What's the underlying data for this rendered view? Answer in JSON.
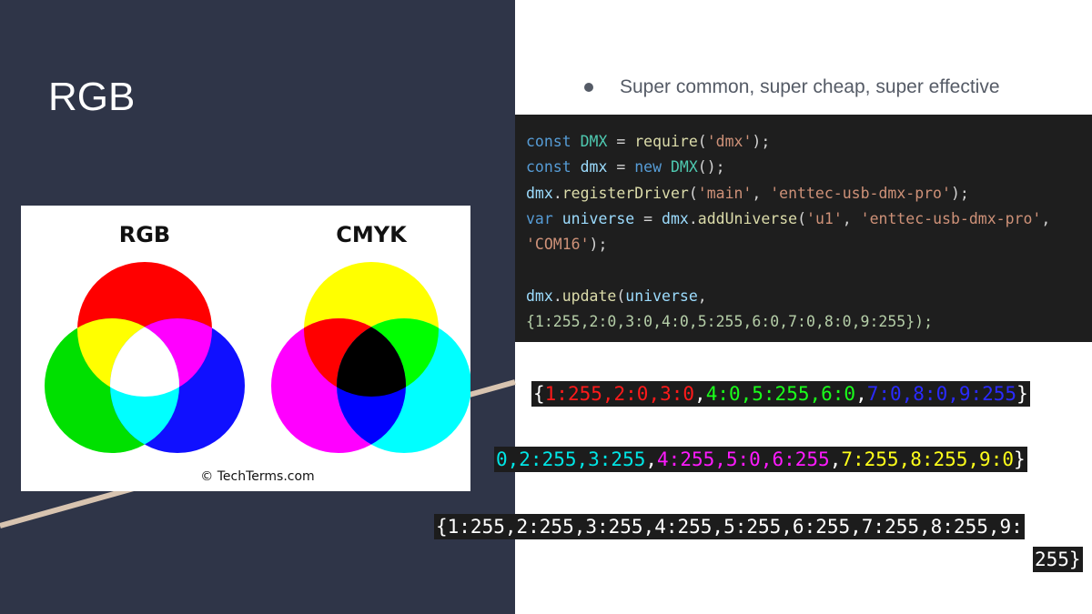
{
  "slide": {
    "title": "RGB",
    "bullet": "Super common, super cheap, super effective"
  },
  "image": {
    "rgb_label": "RGB",
    "cmyk_label": "CMYK",
    "credit": "© TechTerms.com"
  },
  "code": {
    "line1": {
      "k": "const",
      "v": "DMX",
      "op": " = ",
      "f": "require",
      "p1": "(",
      "s": "'dmx'",
      "p2": ");"
    },
    "line2": {
      "k": "const",
      "v": "dmx",
      "op": " = ",
      "k2": "new",
      "c": "DMX",
      "p": "();"
    },
    "line3": {
      "v": "dmx",
      "dot": ".",
      "f": "registerDriver",
      "p1": "(",
      "s1": "'main'",
      "comma": ", ",
      "s2": "'enttec-usb-dmx-pro'",
      "p2": ");"
    },
    "line4": {
      "k": "var",
      "v": "universe",
      "op": " = ",
      "v2": "dmx",
      "dot": ".",
      "f": "addUniverse",
      "p1": "(",
      "s1": "'u1'",
      "comma": ", ",
      "s2": "'enttec-usb-dmx-pro'",
      "p2": ","
    },
    "line5": {
      "s": "'COM16'",
      "p": ");"
    },
    "line6": {
      "v": "dmx",
      "dot": ".",
      "f": "update",
      "p1": "(",
      "v2": "universe",
      "p2": ","
    },
    "line7": {
      "text": "{1:255,2:0,3:0,4:0,5:255,6:0,7:0,8:0,9:255});"
    }
  },
  "dmx_examples": {
    "row1": {
      "open": "{",
      "red": "1:255,2:0,3:0",
      "c1": ",",
      "green": "4:0,5:255,6:0",
      "c2": ",",
      "blue": "7:0,8:0,9:255",
      "close": "}"
    },
    "row2": {
      "cyan": "0,2:255,3:255",
      "c1": ",",
      "magenta": "4:255,5:0,6:255",
      "c2": ",",
      "yellow": "7:255,8:255,9:0",
      "close": "}"
    },
    "row3_a": "{1:255,2:255,3:255,4:255,5:255,6:255,7:255,8:255,9:",
    "row3_b": "255}"
  },
  "colors": {
    "left_panel": "#2f3548",
    "diagonal_line": "#d8c4b0",
    "red": "#ff0000",
    "green": "#00cc00",
    "blue": "#1010ff",
    "cyan": "#00e5e5",
    "magenta": "#ff00ff",
    "yellow": "#ffff00"
  }
}
